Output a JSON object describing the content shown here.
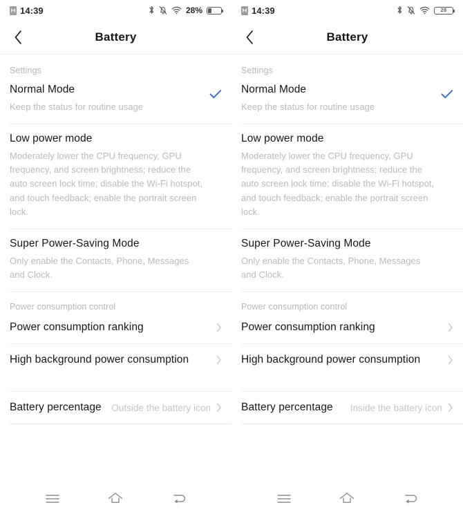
{
  "panels": [
    {
      "status_bar": {
        "time": "14:39",
        "sim_icon": "sim-card-icon",
        "bluetooth_icon": "bluetooth-icon",
        "silent_icon": "bell-muted-icon",
        "wifi_icon": "wifi-icon",
        "battery_percent_text": "28%",
        "battery_percent_inside": "",
        "battery_level": 28,
        "battery_style": "outside"
      },
      "appbar": {
        "back_icon": "chevron-left-icon",
        "title": "Battery"
      },
      "settings_label": "Settings",
      "modes": [
        {
          "title": "Normal Mode",
          "desc": "Keep the status for routine usage",
          "checked": true
        },
        {
          "title": "Low power mode",
          "desc": "Moderately lower the CPU frequency, GPU frequency, and screen brightness; reduce the auto screen lock time; disable the Wi-Fi hotspot, and touch feedback; enable the portrait screen lock.",
          "checked": false
        },
        {
          "title": "Super Power-Saving Mode",
          "desc": "Only enable the Contacts, Phone, Messages and Clock.",
          "checked": false
        }
      ],
      "power_control_label": "Power consumption control",
      "nav_rows": [
        {
          "label": "Power consumption ranking",
          "value": ""
        },
        {
          "label": "High background power consumption",
          "value": ""
        }
      ],
      "battery_percentage_row": {
        "label": "Battery percentage",
        "value": "Outside the battery icon"
      },
      "navbar": {
        "recents_icon": "menu-icon",
        "home_icon": "home-icon",
        "back_icon": "back-return-icon"
      }
    },
    {
      "status_bar": {
        "time": "14:39",
        "sim_icon": "sim-card-icon",
        "bluetooth_icon": "bluetooth-icon",
        "silent_icon": "bell-muted-icon",
        "wifi_icon": "wifi-icon",
        "battery_percent_text": "",
        "battery_percent_inside": "28",
        "battery_level": 28,
        "battery_style": "inside"
      },
      "appbar": {
        "back_icon": "chevron-left-icon",
        "title": "Battery"
      },
      "settings_label": "Settings",
      "modes": [
        {
          "title": "Normal Mode",
          "desc": "Keep the status for routine usage",
          "checked": true
        },
        {
          "title": "Low power mode",
          "desc": "Moderately lower the CPU frequency, GPU frequency, and screen brightness; reduce the auto screen lock time; disable the Wi-Fi hotspot, and touch feedback; enable the portrait screen lock.",
          "checked": false
        },
        {
          "title": "Super Power-Saving Mode",
          "desc": "Only enable the Contacts, Phone, Messages and Clock.",
          "checked": false
        }
      ],
      "power_control_label": "Power consumption control",
      "nav_rows": [
        {
          "label": "Power consumption ranking",
          "value": ""
        },
        {
          "label": "High background power consumption",
          "value": ""
        }
      ],
      "battery_percentage_row": {
        "label": "Battery percentage",
        "value": "Inside the battery icon"
      },
      "navbar": {
        "recents_icon": "menu-icon",
        "home_icon": "home-icon",
        "back_icon": "back-return-icon"
      }
    }
  ],
  "colors": {
    "accent_check": "#3f6fce",
    "primary_text": "#14161a",
    "secondary_text": "#b7babe",
    "divider": "#ededed",
    "icon_gray": "#55585c"
  }
}
